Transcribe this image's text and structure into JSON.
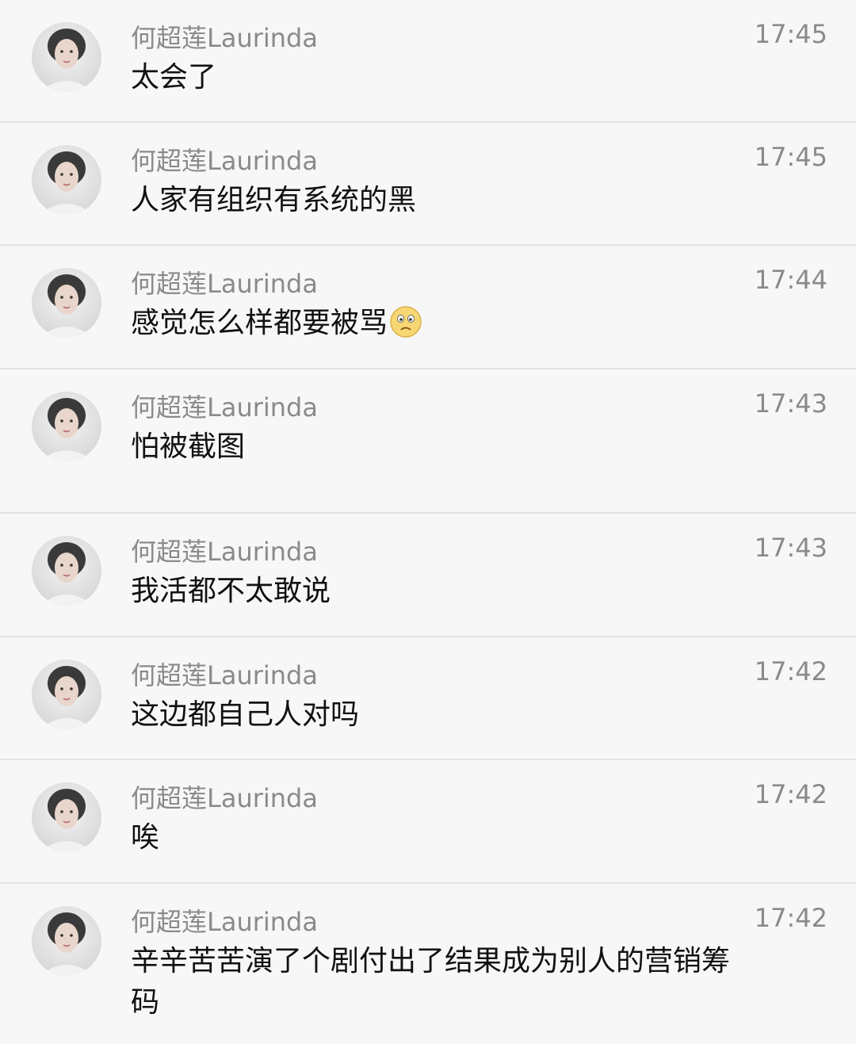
{
  "messages": [
    {
      "sender": "何超莲Laurinda",
      "time": "17:45",
      "text": "太会了",
      "emoji": ""
    },
    {
      "sender": "何超莲Laurinda",
      "time": "17:45",
      "text": "人家有组织有系统的黑",
      "emoji": ""
    },
    {
      "sender": "何超莲Laurinda",
      "time": "17:44",
      "text": "感觉怎么样都要被骂",
      "emoji": "worried-face-icon"
    },
    {
      "sender": "何超莲Laurinda",
      "time": "17:43",
      "text": "怕被截图",
      "emoji": ""
    },
    {
      "sender": "何超莲Laurinda",
      "time": "17:43",
      "text": "我活都不太敢说",
      "emoji": ""
    },
    {
      "sender": "何超莲Laurinda",
      "time": "17:42",
      "text": "这边都自己人对吗",
      "emoji": ""
    },
    {
      "sender": "何超莲Laurinda",
      "time": "17:42",
      "text": "唉",
      "emoji": ""
    },
    {
      "sender": "何超莲Laurinda",
      "time": "17:42",
      "text": "辛辛苦苦演了个剧付出了结果成为别人的营销筹码",
      "emoji": ""
    }
  ],
  "colors": {
    "background": "#f7f7f7",
    "divider": "#e3e3e3",
    "sender": "#8a8a8a",
    "message": "#111111"
  }
}
